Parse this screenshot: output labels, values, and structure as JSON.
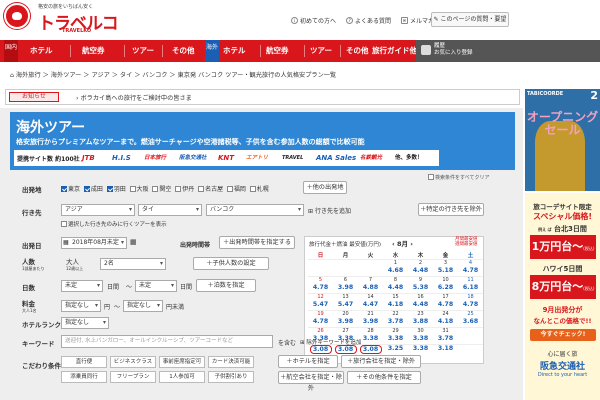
{
  "header": {
    "tagline": "格安の旅をいちばん安く",
    "logo_text": "トラベルコ",
    "logo_sub": "TRAVELKO",
    "links": [
      "初めての方へ",
      "よくある質問",
      "メルマガ"
    ],
    "feedback_button": "このページの質問・要望"
  },
  "nav": {
    "domestic_tag": "国内",
    "overseas_tag": "海外",
    "domestic_items": [
      "ホテル",
      "航空券",
      "ツアー",
      "その他"
    ],
    "overseas_items": [
      "ホテル",
      "航空券",
      "ツアー",
      "その他"
    ],
    "guide": "旅行ガイド他",
    "history_label": "履歴",
    "favorite_label": "お気に入り登録"
  },
  "breadcrumb": "海外旅行 ＞ 海外ツアー ＞ アジア ＞ タイ ＞ バンコク ＞ 東京発 バンコク ツアー・観光旅行の人気格安プラン一覧",
  "notice": {
    "badge": "お知らせ",
    "text": "ボラカイ島への旅行をご検討中の皆さま"
  },
  "hero": {
    "title": "海外ツアー",
    "subtitle": "格安旅行からプレミアムなツアーまで。燃油サーチャージや空港諸税等、子供を含む参加人数の総額で比較可能",
    "partners_label": "提携サイト数 約100社",
    "partner_logos": [
      "JTB",
      "H.I.S",
      "日本旅行",
      "阪急交通社",
      "KNT",
      "エアトリ",
      "TRAVEL",
      "ANA Sales",
      "名鉄観光"
    ],
    "partners_more": "他、多数！",
    "search_note": "検索条件をすべてクリア"
  },
  "form": {
    "departure_label": "出発地",
    "departure_options": [
      "東京",
      "成田",
      "羽田",
      "大阪",
      "関空",
      "伊丹",
      "名古屋",
      "福岡",
      "札幌"
    ],
    "departure_checked": [
      true,
      true,
      true,
      false,
      false,
      false,
      false,
      false,
      false
    ],
    "other_departure_button": "＋他の出発地",
    "destination_label": "行き先",
    "destination_region": "アジア",
    "destination_country": "タイ",
    "destination_city": "バンコク",
    "add_destination": "行き先を追加",
    "exclude_destination_button": "＋特定の行き先を除外",
    "round_trip_note": "選択した行き先のみに行くツアーを表示",
    "date_label": "出発日",
    "date_value": "2018年08月未定",
    "time_label": "出発時間帯",
    "time_button": "＋出発時間帯を指定する",
    "people_label": "人数",
    "people_sub": "1部屋あたり",
    "adult_label": "大人",
    "adult_sub": "12歳以上",
    "adult_value": "2名",
    "child_button": "＋子供人数の設定",
    "days_label": "日数",
    "days_from": "未定",
    "days_unit": "日間",
    "days_to": "未定",
    "stay_button": "＋泊数を指定",
    "price_label": "料金",
    "price_sub": "大人1名",
    "price_min": "指定なし",
    "price_unit": "円",
    "price_max": "指定なし",
    "price_tail": "円未満",
    "rank_label": "ホテルランク",
    "rank_value": "指定なし",
    "keyword_label": "キーワード",
    "keyword_placeholder": "送迎付, 水上バンガロー、オールインクルーシブ、ツアーコードなど",
    "keyword_suffix": "を含む",
    "exclude_keyword": "除外キーワードを追加",
    "more_label": "こだわり条件",
    "chips": [
      "直行便",
      "ビジネスクラス",
      "事前座席指定可",
      "カード決済可能",
      "添乗員同行",
      "フリープラン",
      "1人参加可",
      "子供割引あり"
    ],
    "hotel_button": "＋ホテルを指定",
    "company_button": "＋旅行会社を指定・除外",
    "airline_button": "＋航空会社を指定・除外",
    "other_button": "＋その他条件を指定"
  },
  "calendar": {
    "header": "旅行代金＋燃油 最安値",
    "unit": "(万円)",
    "month": "8月",
    "legend": [
      "月間最安値",
      "週間最安値"
    ],
    "weekdays": [
      "日",
      "月",
      "火",
      "水",
      "木",
      "金",
      "土"
    ],
    "rows": [
      [
        {
          "d": "",
          "p": ""
        },
        {
          "d": "",
          "p": ""
        },
        {
          "d": "",
          "p": ""
        },
        {
          "d": "1",
          "p": "4.68"
        },
        {
          "d": "2",
          "p": "4.48"
        },
        {
          "d": "3",
          "p": "5.18"
        },
        {
          "d": "4",
          "p": "4.78"
        }
      ],
      [
        {
          "d": "5",
          "p": "4.78"
        },
        {
          "d": "6",
          "p": "3.98"
        },
        {
          "d": "7",
          "p": "4.88"
        },
        {
          "d": "8",
          "p": "4.48"
        },
        {
          "d": "9",
          "p": "5.38"
        },
        {
          "d": "10",
          "p": "6.28"
        },
        {
          "d": "11",
          "p": "6.18"
        }
      ],
      [
        {
          "d": "12",
          "p": "5.47"
        },
        {
          "d": "13",
          "p": "5.47"
        },
        {
          "d": "14",
          "p": "4.47"
        },
        {
          "d": "15",
          "p": "4.18"
        },
        {
          "d": "16",
          "p": "4.48"
        },
        {
          "d": "17",
          "p": "4.78"
        },
        {
          "d": "18",
          "p": "4.78"
        }
      ],
      [
        {
          "d": "19",
          "p": "4.78"
        },
        {
          "d": "20",
          "p": "3.98"
        },
        {
          "d": "21",
          "p": "3.98"
        },
        {
          "d": "22",
          "p": "3.78"
        },
        {
          "d": "23",
          "p": "3.88"
        },
        {
          "d": "24",
          "p": "4.18"
        },
        {
          "d": "25",
          "p": "3.68"
        }
      ],
      [
        {
          "d": "26",
          "p": "3.38"
        },
        {
          "d": "27",
          "p": "3.38"
        },
        {
          "d": "28",
          "p": "3.38"
        },
        {
          "d": "29",
          "p": "3.38"
        },
        {
          "d": "30",
          "p": "3.38"
        },
        {
          "d": "31",
          "p": "3.78"
        },
        {
          "d": "",
          "p": ""
        }
      ],
      [
        {
          "d": "",
          "p": "3.08"
        },
        {
          "d": "",
          "p": "3.08"
        },
        {
          "d": "",
          "p": "3.08"
        },
        {
          "d": "",
          "p": "3.25"
        },
        {
          "d": "",
          "p": "3.38"
        },
        {
          "d": "",
          "p": "3.18"
        },
        {
          "d": "",
          "p": ""
        }
      ]
    ],
    "low_cells": [
      [
        5,
        0
      ],
      [
        5,
        1
      ],
      [
        5,
        2
      ]
    ]
  },
  "ad": {
    "brand": "TABICOORDE",
    "number": "2",
    "headline": "オープニング",
    "headline2": "セール",
    "line1": "旅コーデサイト限定",
    "line2": "スペシャル価格!",
    "dest1_prefix": "例え ば",
    "dest1": "台北3日間",
    "price1": "1万円台～",
    "price1_note": "(税込)",
    "dest2": "ハワイ5日間",
    "price2": "8万円台～",
    "price2_note": "(税込)",
    "line3": "9月出発分が",
    "line4": "なんとこの価格で!!",
    "cta": "今すぐチェック!",
    "footer1": "心に届く旅",
    "footer2": "阪急交通社",
    "footer3": "Direct to your heart"
  },
  "colors": {
    "brand_red": "#d9161c",
    "overseas_blue": "#1a5fb4",
    "hero_blue": "#2f86d4"
  }
}
